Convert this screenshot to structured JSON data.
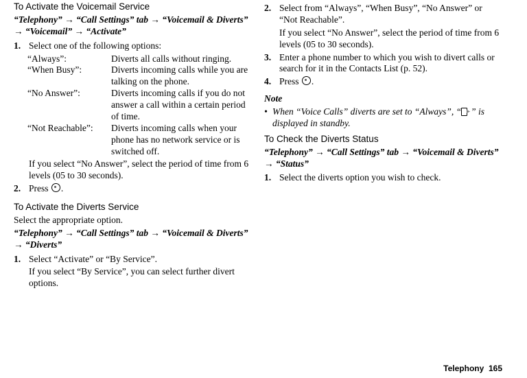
{
  "col1": {
    "sec1": {
      "title": "To Activate the Voicemail Service",
      "path": "“Telephony” → “Call Settings” tab → “Voicemail & Diverts” → “Voicemail” → “Activate”",
      "step1_num": "1.",
      "step1": "Select one of the following options:",
      "opts": [
        {
          "k": "“Always”:",
          "v": "Diverts all calls without ringing."
        },
        {
          "k": "“When Busy”:",
          "v": "Diverts incoming calls while you are talking on the phone."
        },
        {
          "k": "“No Answer”:",
          "v": "Diverts incoming calls if you do not answer a call within a certain period of time."
        },
        {
          "k": "“Not Reachable”:",
          "v": "Diverts incoming calls when your phone has no network service or is switched off."
        }
      ],
      "after_opts": "If you select “No Answer”, select the period of time from 6 levels (05 to 30 seconds).",
      "step2_num": "2.",
      "step2_a": "Press ",
      "step2_b": "."
    },
    "sec2": {
      "title": "To Activate the Diverts Service",
      "pre": "Select the appropriate option.",
      "path": "“Telephony” → “Call Settings” tab → “Voicemail & Diverts” → “Diverts”",
      "step1_num": "1.",
      "step1": "Select “Activate” or “By Service”.",
      "step1_note": "If you select “By Service”, you can select further divert options."
    }
  },
  "col2": {
    "step2_num": "2.",
    "step2": "Select from “Always”, “When Busy”, “No Answer” or “Not Reachable”.",
    "step2_note": "If you select “No Answer”, select the period of time from 6 levels (05 to 30 seconds).",
    "step3_num": "3.",
    "step3": "Enter a phone number to which you wish to divert calls or search for it in the Contacts List (p. 52).",
    "step4_num": "4.",
    "step4_a": "Press ",
    "step4_b": ".",
    "note_hdr": "Note",
    "note_a": "When “Voice Calls” diverts are set to “Always”, “",
    "note_b": "” is displayed in standby.",
    "sec_title": "To Check the Diverts Status",
    "sec_path": "“Telephony” → “Call Settings” tab → “Voicemail & Diverts” → “Status”",
    "step1_num": "1.",
    "step1": "Select the diverts option you wish to check."
  },
  "footer": {
    "label": "Telephony",
    "page": "165"
  }
}
